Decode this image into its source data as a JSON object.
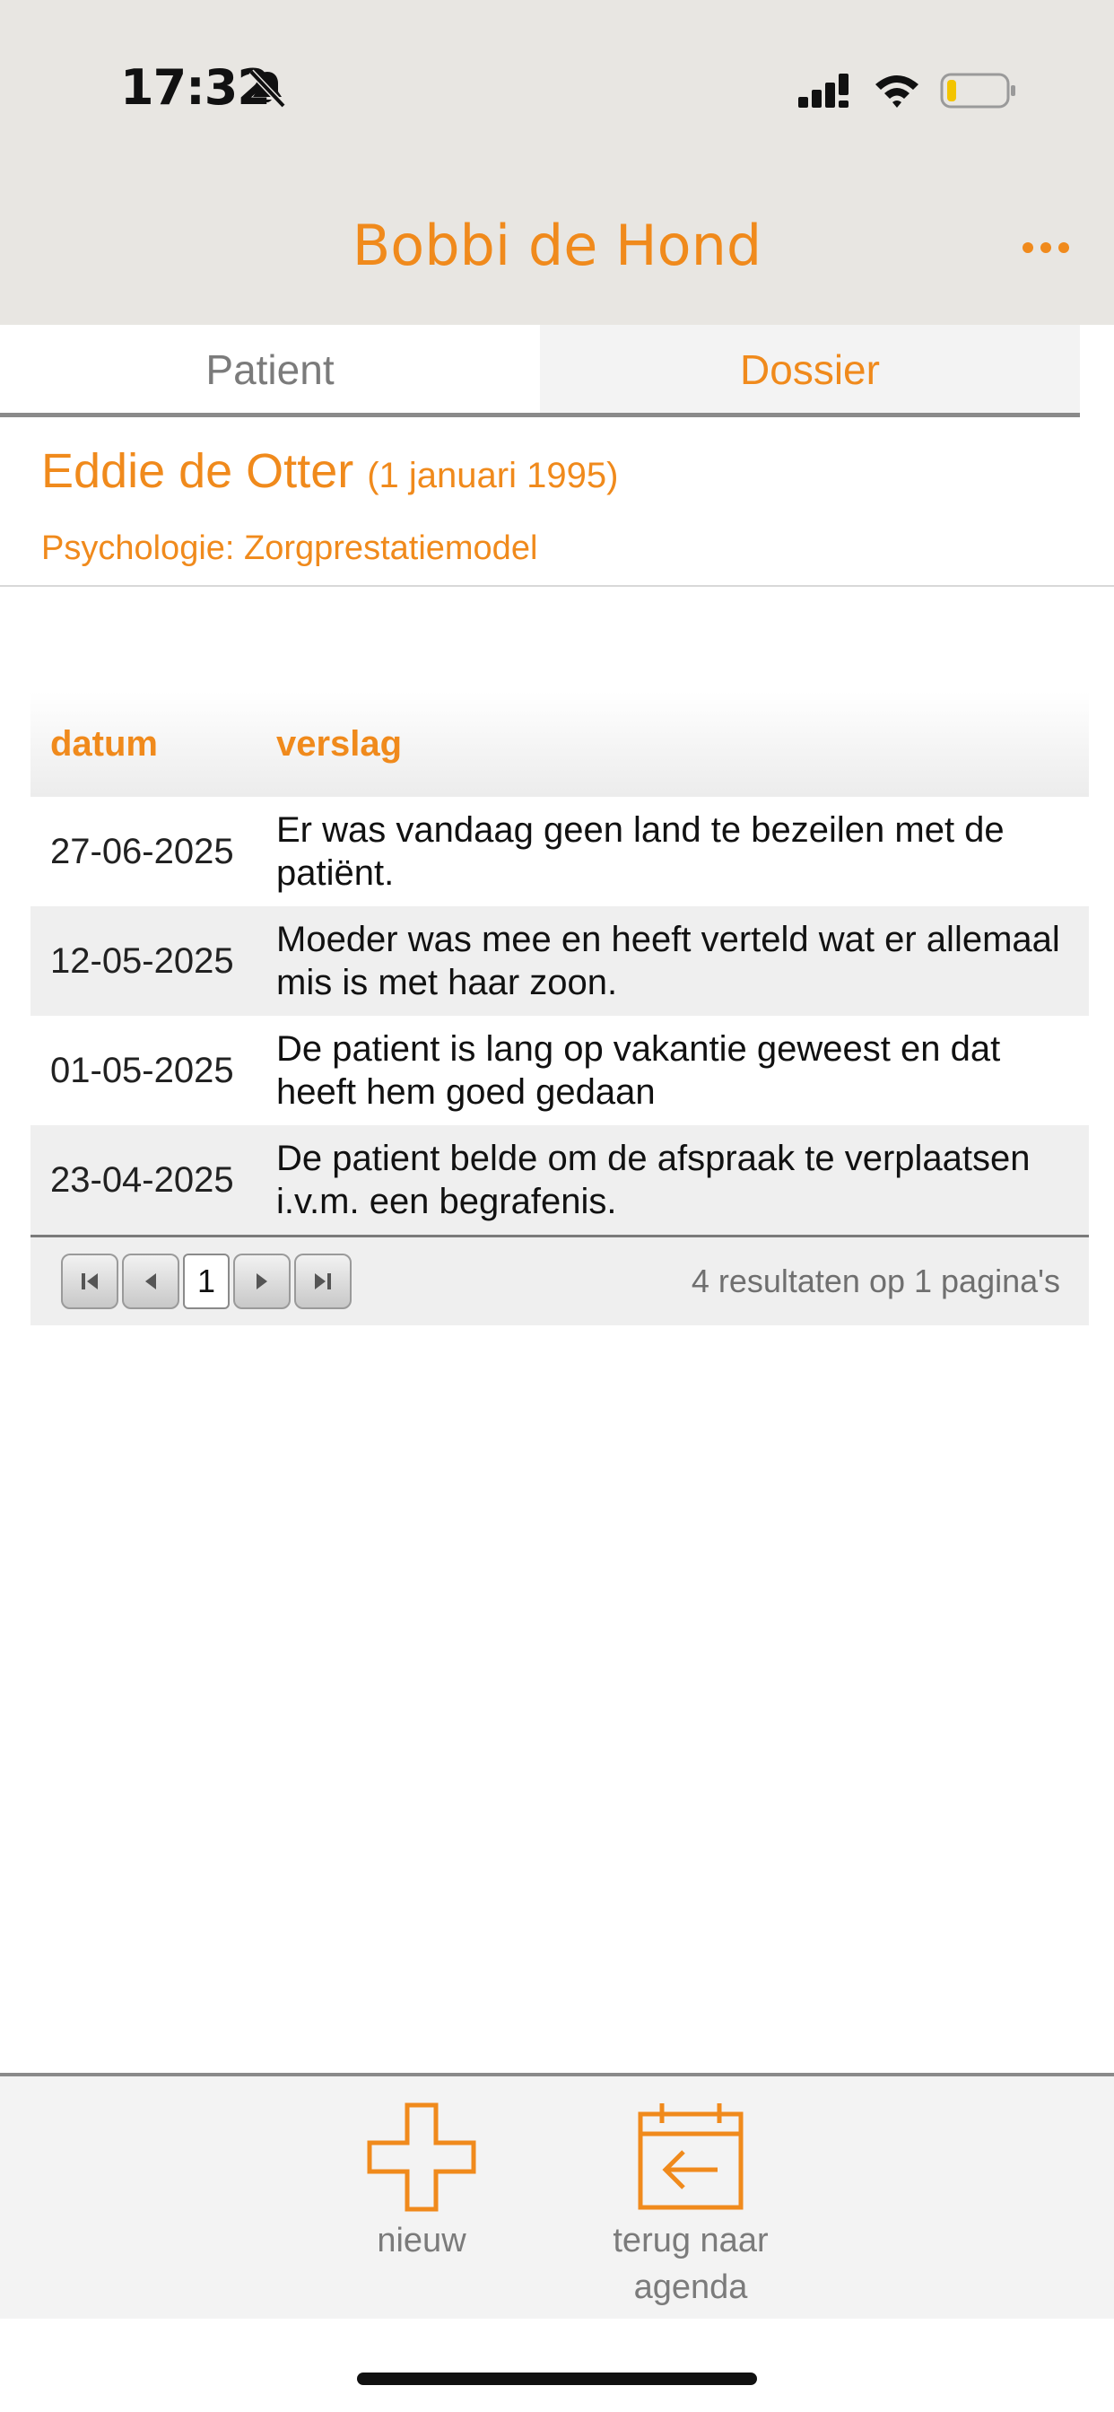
{
  "status_bar": {
    "time": "17:32",
    "icons": [
      "bell-muted-icon",
      "cellular-signal-icon",
      "wifi-icon",
      "battery-low-icon"
    ]
  },
  "header": {
    "title": "Bobbi de Hond",
    "menu_icon": "more-dots-icon",
    "accent_color": "#f08a1c"
  },
  "tabs": [
    {
      "label": "Patient",
      "active": false
    },
    {
      "label": "Dossier",
      "active": true
    }
  ],
  "patient": {
    "name": "Eddie de Otter",
    "dob": "(1 januari 1995)",
    "subtitle": "Psychologie: Zorgprestatiemodel"
  },
  "table": {
    "headers": {
      "date": "datum",
      "report": "verslag"
    },
    "rows": [
      {
        "date": "27-06-2025",
        "report": "Er was vandaag geen land te bezeilen met de patiënt."
      },
      {
        "date": "12-05-2025",
        "report": "Moeder was mee en heeft verteld wat er allemaal mis is met haar zoon."
      },
      {
        "date": "01-05-2025",
        "report": "De patient is lang op vakantie geweest en dat heeft hem goed gedaan"
      },
      {
        "date": "23-04-2025",
        "report": "De patient belde om de afspraak te verplaatsen i.v.m. een begrafenis."
      }
    ],
    "pager": {
      "page": "1",
      "results": "4 resultaten op 1 pagina's"
    }
  },
  "bottom_actions": {
    "new_label": "nieuw",
    "new_icon": "plus-icon",
    "back_label": "terug naar agenda",
    "back_icon": "calendar-back-icon"
  }
}
